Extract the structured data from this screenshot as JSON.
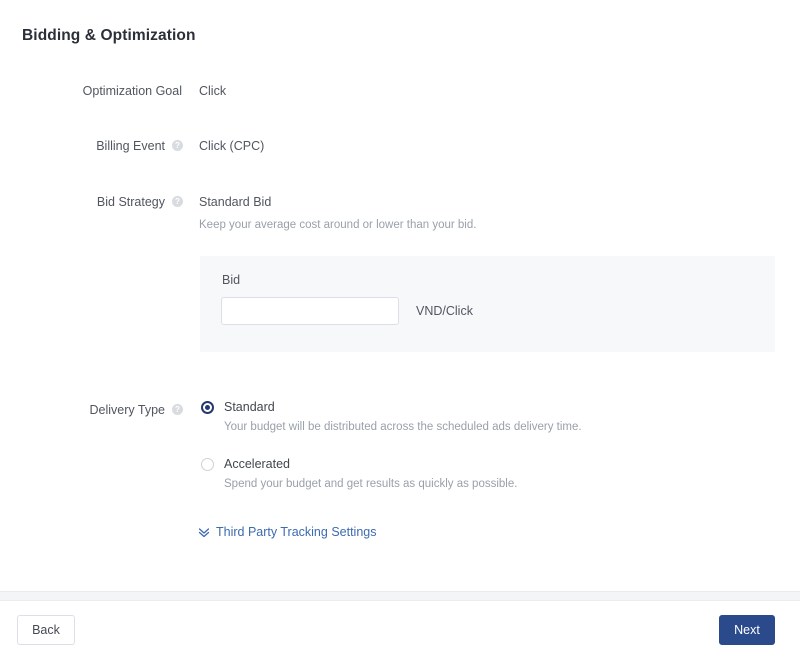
{
  "section": {
    "title": "Bidding & Optimization"
  },
  "fields": {
    "optimization_goal": {
      "label": "Optimization Goal",
      "value": "Click"
    },
    "billing_event": {
      "label": "Billing Event",
      "value": "Click (CPC)",
      "help_icon": "question-mark-icon",
      "help_glyph": "?"
    },
    "bid_strategy": {
      "label": "Bid Strategy",
      "value": "Standard Bid",
      "hint": "Keep your average cost around or lower than your bid.",
      "help_icon": "question-mark-icon",
      "help_glyph": "?"
    },
    "delivery_type": {
      "label": "Delivery Type",
      "help_icon": "question-mark-icon",
      "help_glyph": "?"
    }
  },
  "bid_panel": {
    "label": "Bid",
    "input_value": "",
    "input_placeholder": "",
    "unit": "VND/Click"
  },
  "delivery_options": [
    {
      "label": "Standard",
      "description": "Your budget will be distributed across the scheduled ads delivery time.",
      "selected": true
    },
    {
      "label": "Accelerated",
      "description": "Spend your budget and get results as quickly as possible.",
      "selected": false
    }
  ],
  "tracking": {
    "link_label": "Third Party Tracking Settings",
    "icon": "double-chevron-down-icon"
  },
  "footer": {
    "back_label": "Back",
    "next_label": "Next"
  },
  "colors": {
    "accent": "#2a4a8b",
    "link": "#3d6ab0",
    "radio_selected": "#25396f",
    "panel_bg": "#f7f8fa",
    "muted_text": "#9aa0aa"
  }
}
